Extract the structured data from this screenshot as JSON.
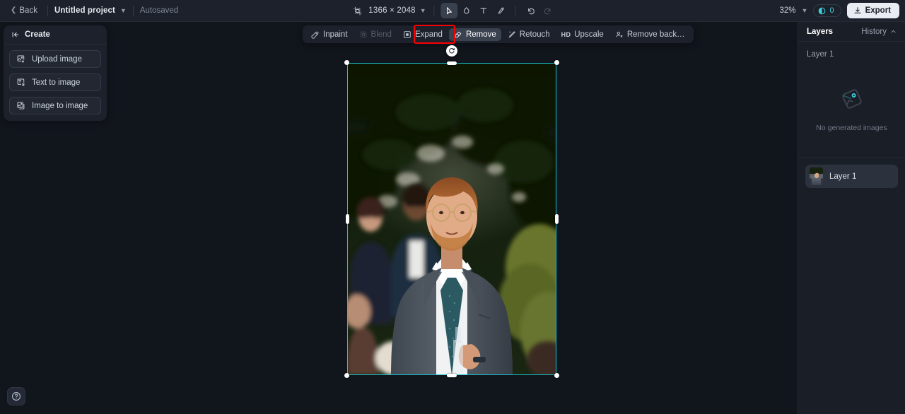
{
  "app": {
    "background_color": "#11151c",
    "panel_color": "#1d212b",
    "accent_cyan": "#17c4d4",
    "annotation_color": "#fb0000"
  },
  "topbar": {
    "back_label": "Back",
    "project_name": "Untitled project",
    "autosave_label": "Autosaved",
    "canvas_size": "1366 × 2048",
    "zoom_level": "32%",
    "credits_count": "0",
    "export_label": "Export",
    "tools": [
      {
        "name": "crop-resize-icon",
        "label": "Resize canvas",
        "active": false
      },
      {
        "name": "select-tool",
        "label": "Select",
        "active": true
      },
      {
        "name": "mask-tool",
        "label": "Mask",
        "active": false
      },
      {
        "name": "text-tool",
        "label": "Text",
        "active": false
      },
      {
        "name": "brush-tool",
        "label": "Brush",
        "active": false
      },
      {
        "name": "undo-button",
        "label": "Undo",
        "active": false
      },
      {
        "name": "redo-button",
        "label": "Redo",
        "active": false
      }
    ]
  },
  "subtoolbar": {
    "items": [
      {
        "label": "Inpaint",
        "icon": "inpaint-icon",
        "state": "normal"
      },
      {
        "label": "Blend",
        "icon": "blend-icon",
        "state": "disabled"
      },
      {
        "label": "Expand",
        "icon": "expand-icon",
        "state": "normal"
      },
      {
        "label": "Remove",
        "icon": "eraser-icon",
        "state": "active"
      },
      {
        "label": "Retouch",
        "icon": "retouch-icon",
        "state": "normal"
      },
      {
        "label": "Upscale",
        "icon": "hd-icon",
        "state": "normal",
        "badge": "HD"
      },
      {
        "label": "Remove back…",
        "icon": "remove-background-icon",
        "state": "normal"
      }
    ]
  },
  "left_panel": {
    "title": "Create",
    "collapse_icon": "collapse-panel-icon",
    "buttons": [
      {
        "label": "Upload image",
        "icon": "upload-image-icon"
      },
      {
        "label": "Text to image",
        "icon": "text-to-image-icon"
      },
      {
        "label": "Image to image",
        "icon": "image-to-image-icon"
      }
    ]
  },
  "right_panel": {
    "tab_layers": "Layers",
    "tab_history": "History",
    "section_label": "Layer 1",
    "empty_state_text": "No generated images",
    "empty_state_icon": "no-images-icon",
    "layers": [
      {
        "label": "Layer 1",
        "selected": true
      }
    ]
  },
  "canvas": {
    "selection": {
      "rotate_handle_icon": "rotate-icon",
      "handles": [
        "top-left",
        "top-right",
        "bottom-left",
        "bottom-right",
        "top-center",
        "bottom-center",
        "left-center",
        "right-center"
      ]
    },
    "image_description": "Man with ginger hair, beard and round glasses wearing a grey suit and teal tie, holding a champagne flute at an outdoor garden event"
  },
  "help": {
    "icon": "help-icon",
    "label": "Help"
  }
}
